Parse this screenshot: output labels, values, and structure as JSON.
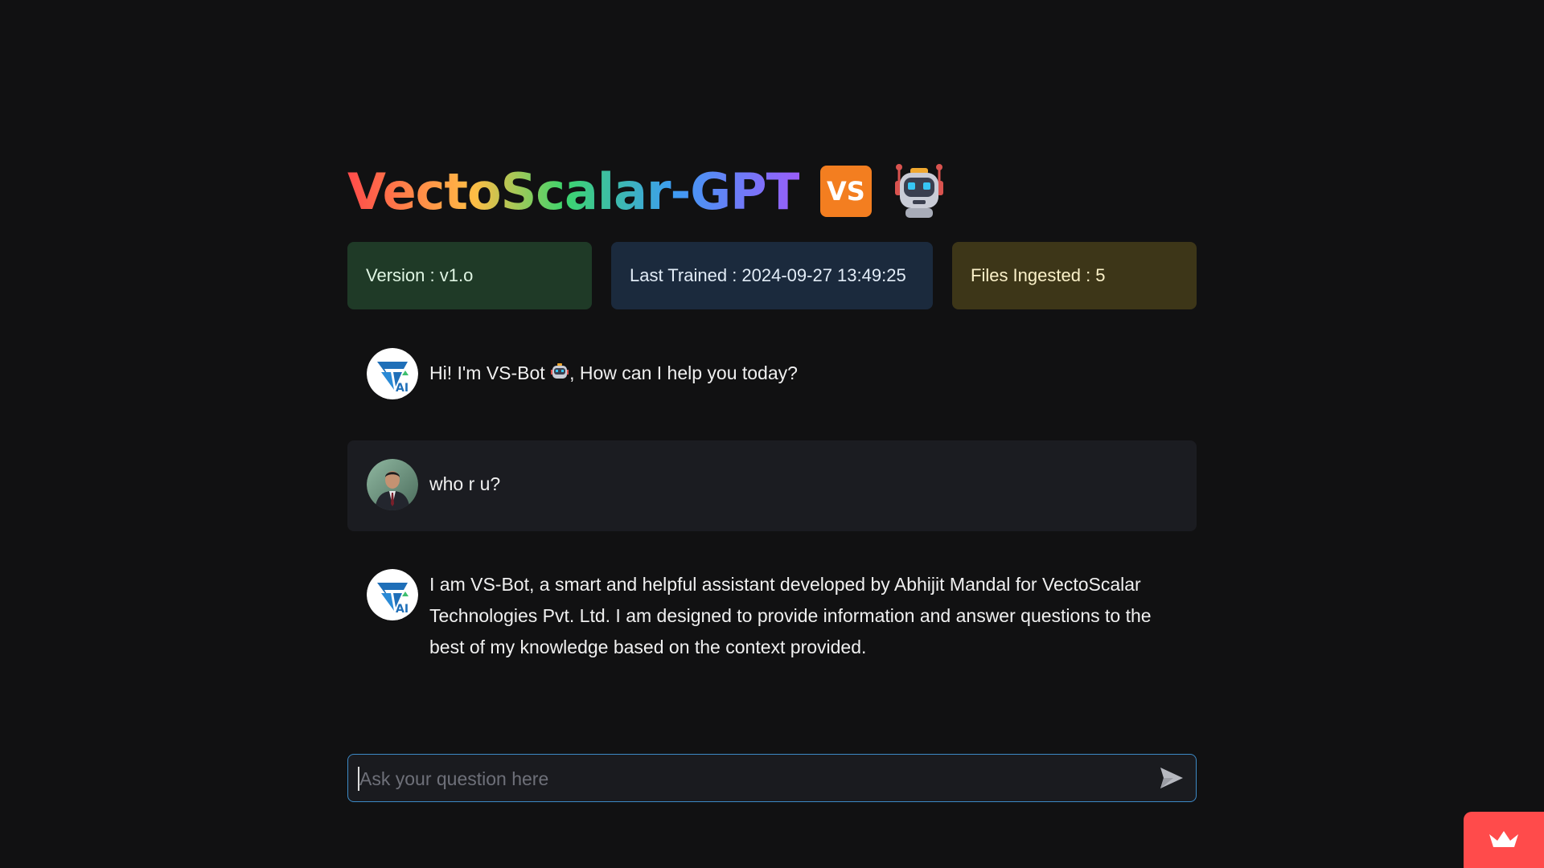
{
  "app": {
    "title": "VectoScalar-GPT",
    "logo_text": "VS",
    "robot_icon": "robot-face-icon"
  },
  "info_cards": {
    "version": "Version : v1.o",
    "last_trained": "Last Trained : 2024-09-27 13:49:25",
    "files_ingested": "Files Ingested : 5"
  },
  "messages": [
    {
      "role": "assistant",
      "avatar": "vs-ai-logo-avatar",
      "text_before_icon": "Hi! I'm VS-Bot ",
      "inline_icon": "robot-face-icon",
      "text_after_icon": ", How can I help you today?"
    },
    {
      "role": "user",
      "avatar": "user-photo-avatar",
      "text": "who r u?"
    },
    {
      "role": "assistant",
      "avatar": "vs-ai-logo-avatar",
      "text": "I am VS-Bot, a smart and helpful assistant developed by Abhijit Mandal for VectoScalar Technologies Pvt. Ltd. I am designed to provide information and answer questions to the best of my knowledge based on the context provided."
    }
  ],
  "chat_input": {
    "placeholder": "Ask your question here",
    "value": "",
    "send_icon": "send-arrow-icon"
  },
  "badge": {
    "icon": "crown-icon"
  },
  "colors": {
    "background": "#111112",
    "version_card": "#1f3a27",
    "trained_card": "#1b2a3d",
    "files_card": "#3d3618",
    "logo_orange": "#f37e20",
    "input_border": "#3c89c6",
    "badge_red": "#ff4b4b"
  }
}
